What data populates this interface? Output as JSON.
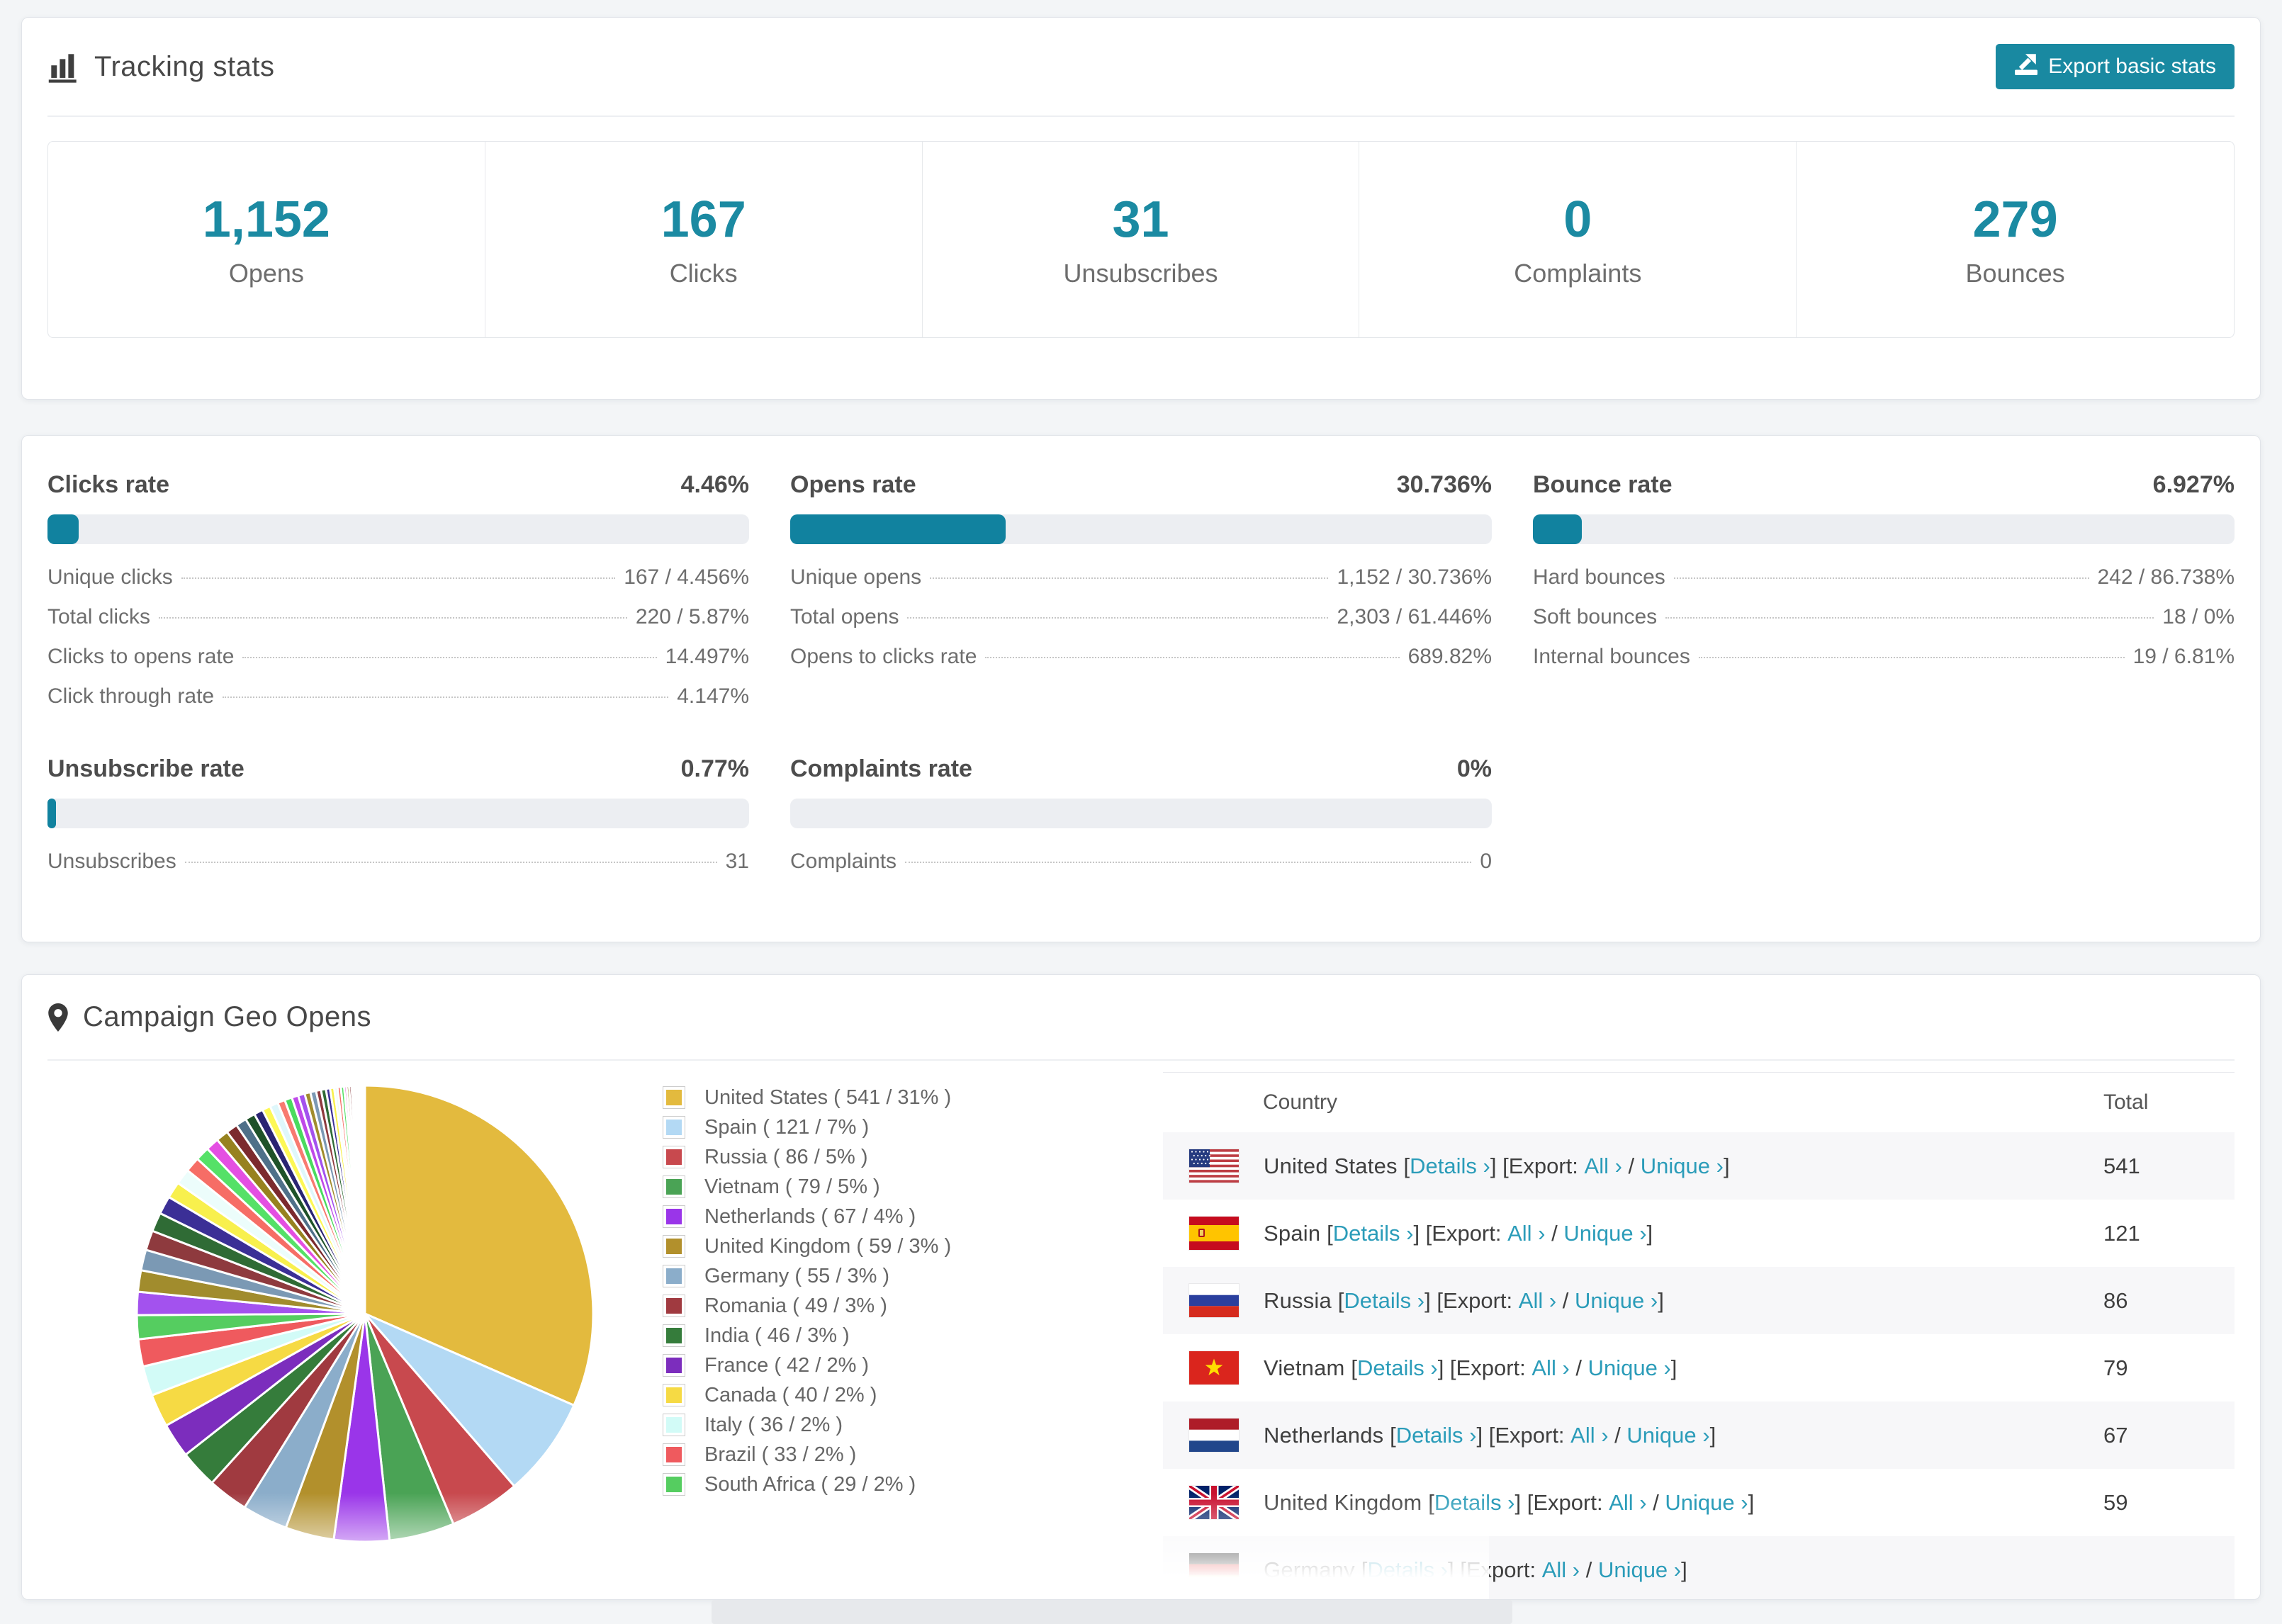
{
  "colors": {
    "accent_teal": "#1b8aa2",
    "button_teal": "#1989a1",
    "bar_fill_teal": "#11829f",
    "link_teal": "#2b9cb9",
    "bar_track": "#eceef2"
  },
  "tracking": {
    "title": "Tracking stats",
    "icon": "bar-chart-icon",
    "export_button": {
      "label": "Export basic stats",
      "icon": "export-icon"
    },
    "stats": [
      {
        "value": "1,152",
        "label": "Opens"
      },
      {
        "value": "167",
        "label": "Clicks"
      },
      {
        "value": "31",
        "label": "Unsubscribes"
      },
      {
        "value": "0",
        "label": "Complaints"
      },
      {
        "value": "279",
        "label": "Bounces"
      }
    ]
  },
  "rates": {
    "sections": [
      {
        "id": "clicks",
        "title": "Clicks rate",
        "value": "4.46%",
        "pct": 4.46,
        "rows": [
          {
            "label": "Unique clicks",
            "value": "167 / 4.456%"
          },
          {
            "label": "Total clicks",
            "value": "220 / 5.87%"
          },
          {
            "label": "Clicks to opens rate",
            "value": "14.497%"
          },
          {
            "label": "Click through rate",
            "value": "4.147%"
          }
        ]
      },
      {
        "id": "opens",
        "title": "Opens rate",
        "value": "30.736%",
        "pct": 30.736,
        "rows": [
          {
            "label": "Unique opens",
            "value": "1,152 / 30.736%"
          },
          {
            "label": "Total opens",
            "value": "2,303 / 61.446%"
          },
          {
            "label": "Opens to clicks rate",
            "value": "689.82%"
          }
        ]
      },
      {
        "id": "bounce",
        "title": "Bounce rate",
        "value": "6.927%",
        "pct": 6.927,
        "rows": [
          {
            "label": "Hard bounces",
            "value": "242 / 86.738%"
          },
          {
            "label": "Soft bounces",
            "value": "18 / 0%"
          },
          {
            "label": "Internal bounces",
            "value": "19 / 6.81%"
          }
        ]
      },
      {
        "id": "unsubscribe",
        "title": "Unsubscribe rate",
        "value": "0.77%",
        "pct": 0.77,
        "rows": [
          {
            "label": "Unsubscribes",
            "value": "31"
          }
        ]
      },
      {
        "id": "complaints",
        "title": "Complaints rate",
        "value": "0%",
        "pct": 0,
        "rows": [
          {
            "label": "Complaints",
            "value": "0"
          }
        ]
      }
    ]
  },
  "geo": {
    "title": "Campaign Geo Opens",
    "icon": "map-pin-icon",
    "table": {
      "columns": [
        "Country",
        "Total"
      ],
      "link_details": "Details ›",
      "export_prefix": "Export:",
      "link_all": "All ›",
      "link_unique": "Unique ›",
      "rows": [
        {
          "country": "United States",
          "flag": "us",
          "total": "541"
        },
        {
          "country": "Spain",
          "flag": "es",
          "total": "121"
        },
        {
          "country": "Russia",
          "flag": "ru",
          "total": "86"
        },
        {
          "country": "Vietnam",
          "flag": "vn",
          "total": "79"
        },
        {
          "country": "Netherlands",
          "flag": "nl",
          "total": "67"
        },
        {
          "country": "United Kingdom",
          "flag": "gb",
          "total": "59"
        },
        {
          "country": "Germany",
          "flag": "de",
          "total": ""
        }
      ]
    }
  },
  "chart_data": {
    "type": "pie",
    "title": "Campaign Geo Opens",
    "legend_position": "right",
    "start_angle_deg": -90,
    "direction": "clockwise",
    "series": [
      {
        "label": "United States",
        "value": 541,
        "pct": "31%",
        "color": "#e3ba3e"
      },
      {
        "label": "Spain",
        "value": 121,
        "pct": "7%",
        "color": "#b3d9f4"
      },
      {
        "label": "Russia",
        "value": 86,
        "pct": "5%",
        "color": "#c8494e"
      },
      {
        "label": "Vietnam",
        "value": 79,
        "pct": "5%",
        "color": "#4aa355"
      },
      {
        "label": "Netherlands",
        "value": 67,
        "pct": "4%",
        "color": "#9a35e9"
      },
      {
        "label": "United Kingdom",
        "value": 59,
        "pct": "3%",
        "color": "#b2902c"
      },
      {
        "label": "Germany",
        "value": 55,
        "pct": "3%",
        "color": "#8badca"
      },
      {
        "label": "Romania",
        "value": 49,
        "pct": "3%",
        "color": "#a03a40"
      },
      {
        "label": "India",
        "value": 46,
        "pct": "3%",
        "color": "#357c3b"
      },
      {
        "label": "France",
        "value": 42,
        "pct": "2%",
        "color": "#7c2dbd"
      },
      {
        "label": "Canada",
        "value": 40,
        "pct": "2%",
        "color": "#f6da44"
      },
      {
        "label": "Italy",
        "value": 36,
        "pct": "2%",
        "color": "#d2fbf7"
      },
      {
        "label": "Brazil",
        "value": 33,
        "pct": "2%",
        "color": "#ef5a5e"
      },
      {
        "label": "South Africa",
        "value": 29,
        "pct": "2%",
        "color": "#55cd60"
      }
    ],
    "other_slices_estimated": {
      "note": "unlabeled small slices, values estimated from pie",
      "values": [
        28,
        26,
        25,
        24,
        23,
        22,
        20,
        19,
        18,
        17,
        16,
        15,
        14,
        13,
        12,
        11,
        10,
        10,
        9,
        9,
        8,
        8,
        7,
        7,
        6,
        6,
        5,
        5,
        4,
        4,
        4,
        3,
        3,
        3,
        2,
        2,
        2,
        2,
        1,
        1,
        1,
        1,
        1,
        1,
        1,
        1
      ],
      "palette": [
        "#a352ee",
        "#a18c2d",
        "#7b99b4",
        "#8e3a3e",
        "#2f6b35",
        "#3b2f96",
        "#f8f04d",
        "#ecfdfb",
        "#f66d66",
        "#55e167",
        "#e44fe2",
        "#97821f",
        "#7c2a2e",
        "#4f7089",
        "#1f5229",
        "#2a2472",
        "#fdf855",
        "#dff7fb",
        "#f87a70",
        "#4adb5e",
        "#bf49e9"
      ]
    }
  }
}
